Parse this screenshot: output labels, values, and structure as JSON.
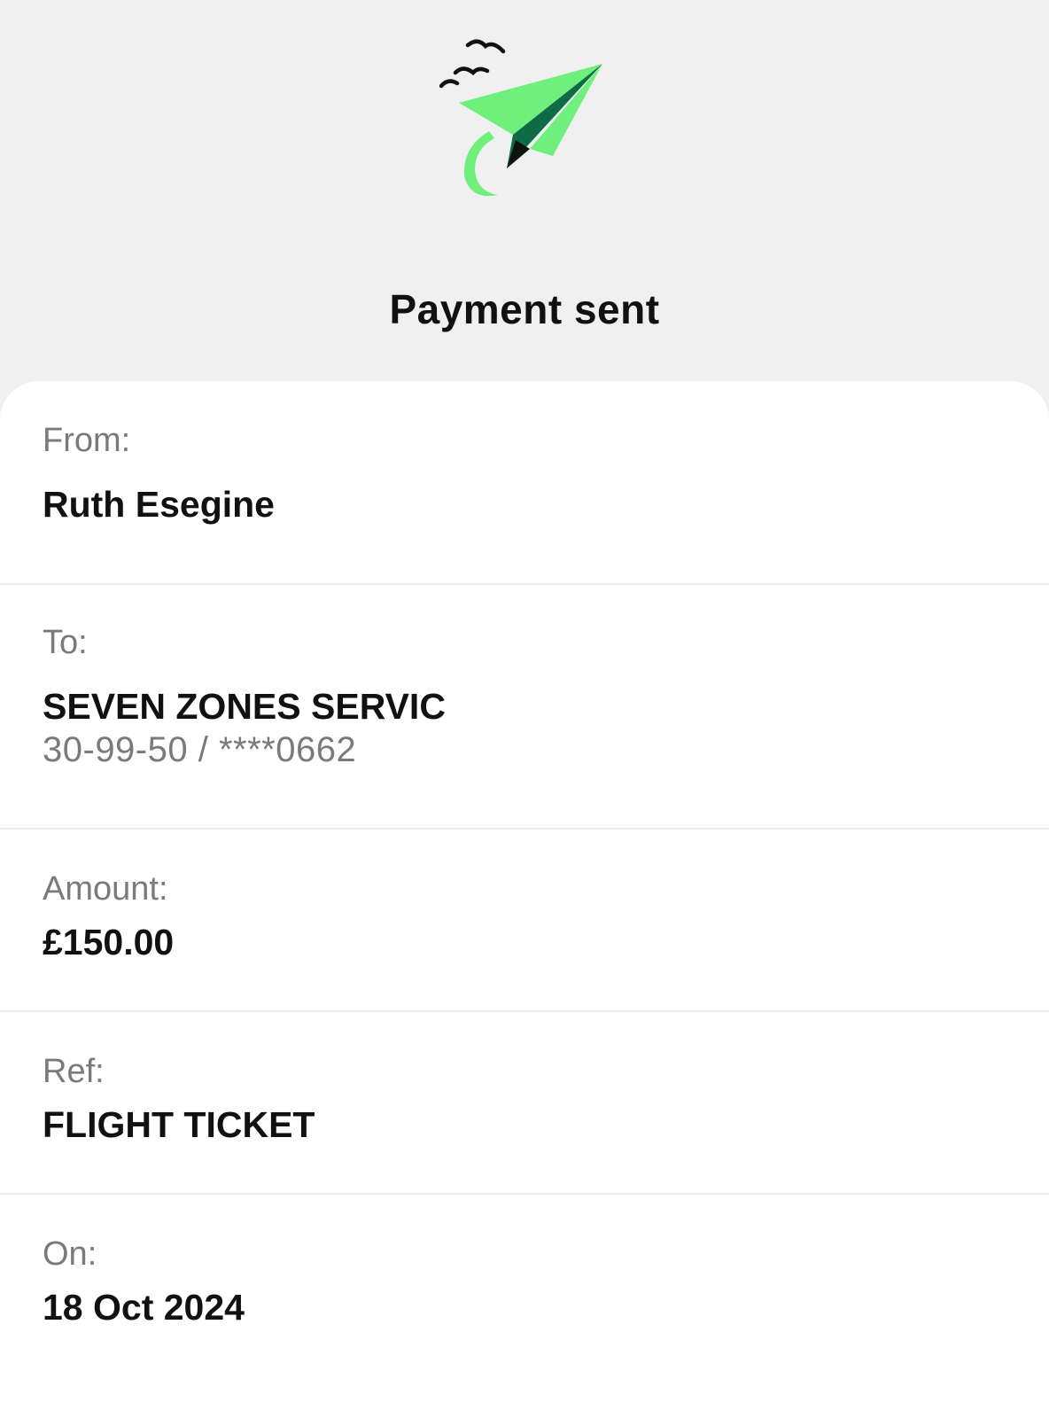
{
  "header": {
    "title": "Payment sent",
    "logo_icon": "paper-plane-birds-icon",
    "logo_colors": {
      "light_green": "#6ff07c",
      "dark_green": "#0d6b45",
      "black": "#111111"
    }
  },
  "details": {
    "from": {
      "label": "From:",
      "value": "Ruth Esegine"
    },
    "to": {
      "label": "To:",
      "value": "SEVEN ZONES SERVIC",
      "account": "30-99-50 / ****0662"
    },
    "amount": {
      "label": "Amount:",
      "value": "£150.00"
    },
    "ref": {
      "label": "Ref:",
      "value": "FLIGHT TICKET"
    },
    "on": {
      "label": "On:",
      "value": "18 Oct 2024"
    }
  }
}
